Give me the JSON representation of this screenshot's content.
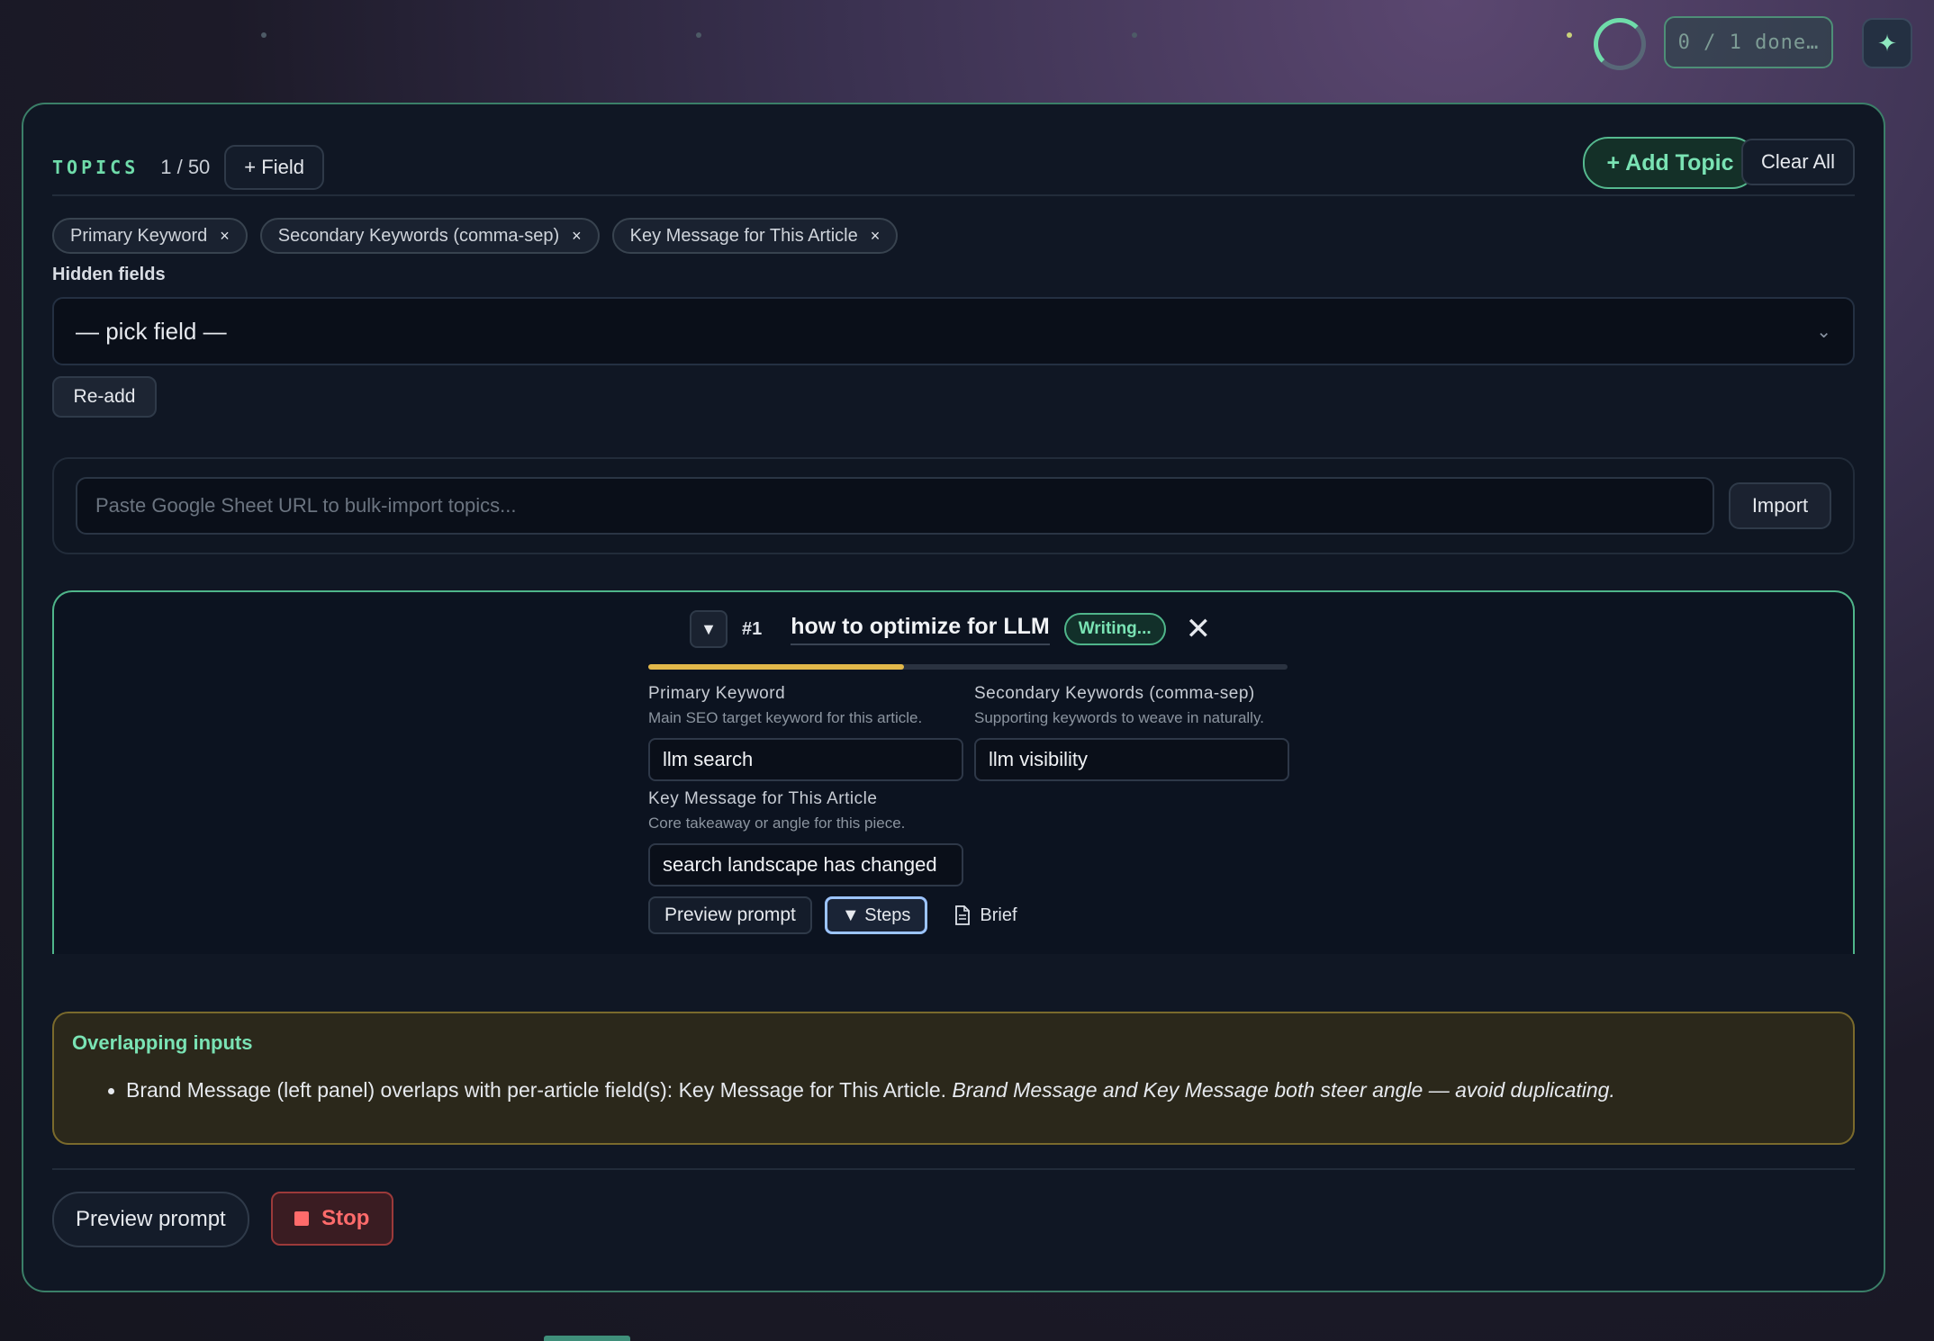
{
  "topbar": {
    "progress_label": "0 / 1 done…",
    "sparkle_icon": "sparkle-icon"
  },
  "topics": {
    "title": "TOPICS",
    "count": "1 / 50",
    "add_field_label": "+ Field",
    "add_topic_label": "+ Add Topic",
    "clear_all_label": "Clear All",
    "field_chips": [
      {
        "label": "Primary Keyword"
      },
      {
        "label": "Secondary Keywords (comma-sep)"
      },
      {
        "label": "Key Message for This Article"
      }
    ],
    "chip_remove_glyph": "×",
    "hidden_fields_label": "Hidden fields",
    "hidden_select_value": "— pick field —",
    "readd_label": "Re-add",
    "import": {
      "placeholder": "Paste Google Sheet URL to bulk-import topics...",
      "button_label": "Import"
    }
  },
  "topic_card": {
    "collapse_glyph": "▼",
    "number": "#1",
    "title": "how to optimize for LLM",
    "status": "Writing...",
    "progress": 0.4,
    "fields": [
      {
        "label": "Primary Keyword",
        "help": "Main SEO target keyword for this article.",
        "value": "llm search"
      },
      {
        "label": "Secondary Keywords (comma-sep)",
        "help": "Supporting keywords to weave in naturally.",
        "value": "llm visibility"
      },
      {
        "label": "Key Message for This Article",
        "help": "Core takeaway or angle for this piece.",
        "value": "search landscape has changed"
      }
    ],
    "preview_label": "Preview prompt",
    "steps_label": "▼ Steps",
    "brief_label": "Brief"
  },
  "overlap": {
    "title": "Overlapping inputs",
    "item_text": "Brand Message (left panel) overlaps with per-article field(s): Key Message for This Article.",
    "item_note": "Brand Message and Key Message both steer angle — avoid duplicating."
  },
  "footer": {
    "preview_label": "Preview prompt",
    "stop_label": "Stop"
  },
  "colors": {
    "accent": "#6fdcaa",
    "progress": "#e2b84a",
    "danger": "#ff6b6b",
    "warning_bg": "#2b281b"
  }
}
